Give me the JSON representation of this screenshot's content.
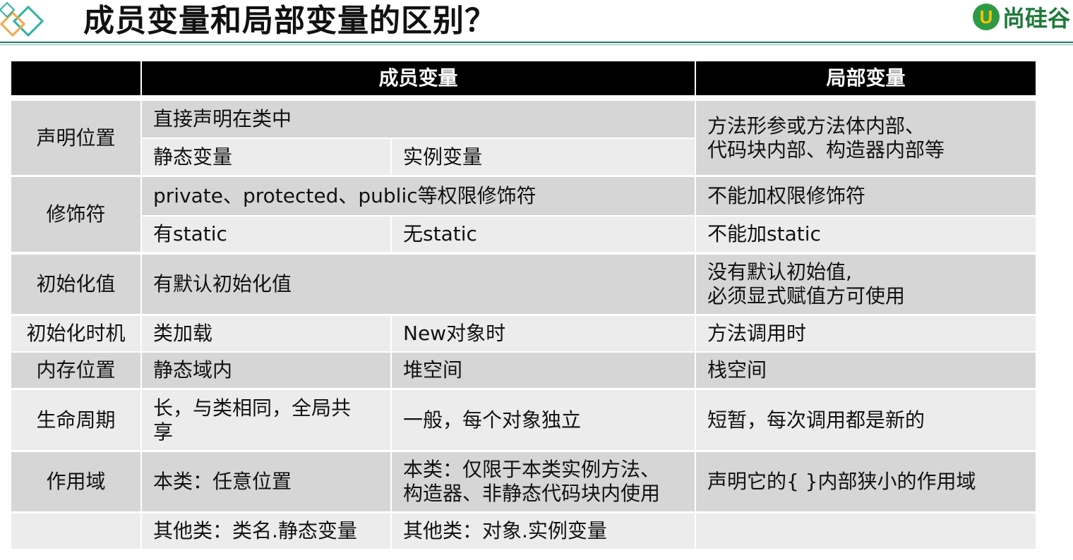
{
  "title": "成员变量和局部变量的区别？",
  "logo": {
    "mark": "U",
    "text": "尚硅谷"
  },
  "table": {
    "headers": [
      "",
      "成员变量",
      "局部变量"
    ],
    "rows": {
      "decl": {
        "label": "声明位置",
        "member": "直接声明在类中",
        "static": "静态变量",
        "instance": "实例变量",
        "local": "方法形参或方法体内部、\n代码块内部、构造器内部等"
      },
      "modifier": {
        "label": "修饰符",
        "member": "private、protected、public等权限修饰符",
        "local": "不能加权限修饰符",
        "static": "有static",
        "instance": "无static",
        "local2": "不能加static"
      },
      "init": {
        "label": "初始化值",
        "member": "有默认初始化值",
        "local": "没有默认初始值,\n必须显式赋值方可使用"
      },
      "timing": {
        "label": "初始化时机",
        "static": "类加载",
        "instance": "New对象时",
        "local": "方法调用时"
      },
      "memory": {
        "label": "内存位置",
        "static": "静态域内",
        "instance": "堆空间",
        "local": "栈空间"
      },
      "life": {
        "label": "生命周期",
        "static": "长，与类相同，全局共\n享",
        "instance": "一般，每个对象独立",
        "local": "短暂，每次调用都是新的"
      },
      "scope": {
        "label": "作用域",
        "static": "本类：任意位置",
        "instance": "本类：仅限于本类实例方法、\n构造器、非静态代码块内使用",
        "local": "声明它的{ }内部狭小的作用域",
        "static2": "其他类：类名.静态变量",
        "instance2": "其他类：对象.实例变量"
      }
    }
  }
}
